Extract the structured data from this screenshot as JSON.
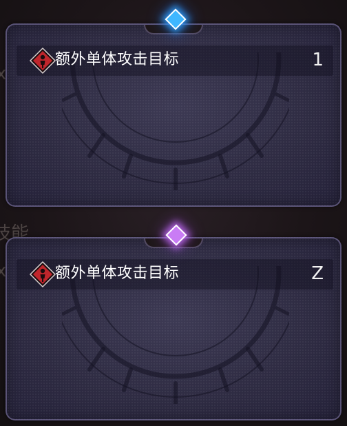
{
  "background": {
    "fragment_top": "x",
    "fragment_mid": "技能",
    "fragment_mid2": "x"
  },
  "cards": [
    {
      "gem_color": "#3fb7ff",
      "attribute": {
        "icon": "red-diamond-person-icon",
        "label": "额外单体攻击目标",
        "value": "1"
      }
    },
    {
      "gem_color": "#c97cf5",
      "attribute": {
        "icon": "red-diamond-person-icon",
        "label": "额外单体攻击目标",
        "value": "Z"
      }
    }
  ],
  "colors": {
    "icon_red": "#c0262c",
    "card_bg": "#2e2b42",
    "card_border": "#968cbe"
  }
}
